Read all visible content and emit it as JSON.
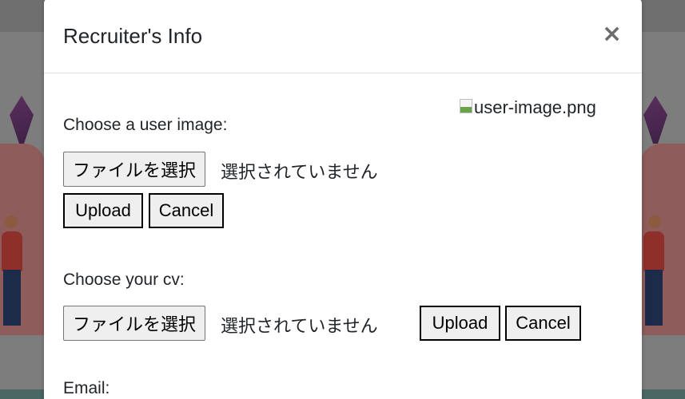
{
  "modal": {
    "title": "Recruiter's Info",
    "close_label": "×"
  },
  "user_image": {
    "label": "Choose a user image:",
    "image_alt": "user-image.png",
    "file_button": "ファイルを選択",
    "file_status": "選択されていません",
    "upload_label": "Upload",
    "cancel_label": "Cancel"
  },
  "cv": {
    "label": "Choose your cv:",
    "file_button": "ファイルを選択",
    "file_status": "選択されていません",
    "upload_label": "Upload",
    "cancel_label": "Cancel"
  },
  "email": {
    "label": "Email:"
  },
  "colors": {
    "overlay": "#7d7d7d",
    "modal_bg": "#ffffff",
    "text": "#212529",
    "close": "#6c6c6c"
  }
}
